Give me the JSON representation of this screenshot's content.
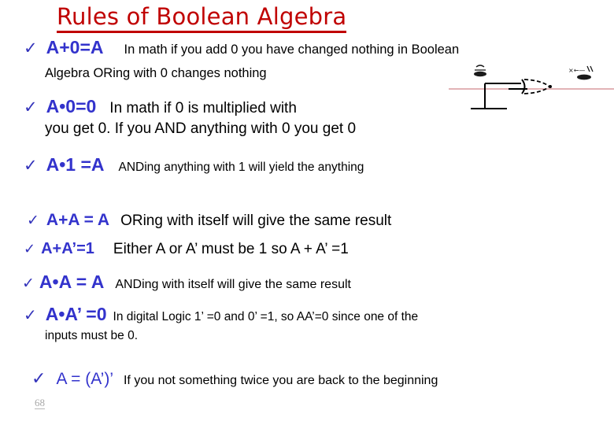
{
  "slide": {
    "title": "Rules of Boolean Algebra",
    "title_color": "#c00000",
    "expr_color": "#3333cc",
    "check_color": "#3333bb",
    "body_color": "#000000",
    "background": "#ffffff",
    "page_number": "68",
    "check_glyph": "✓"
  },
  "rules": [
    {
      "id": "rule-a-plus-0",
      "expression": "A+0=A",
      "description": "In math if you add 0 you have changed nothing in Boolean",
      "continuation": "Algebra ORing with 0 changes nothing"
    },
    {
      "id": "rule-a-times-0",
      "expression": "A•0=0",
      "description": "In math if 0 is multiplied with",
      "continuation": "you get 0. If you AND anything with 0 you get 0"
    },
    {
      "id": "rule-a-times-1",
      "expression": "A•1 =A",
      "description": "ANDing anything with 1 will yield the anything",
      "continuation": ""
    },
    {
      "id": "rule-a-plus-a",
      "expression": "A+A = A",
      "description": "ORing with itself will give the same result",
      "continuation": ""
    },
    {
      "id": "rule-a-plus-a-not",
      "expression": "A+A’=1",
      "description": "Either A or A’ must be 1 so A + A’ =1",
      "continuation": ""
    },
    {
      "id": "rule-a-times-a",
      "expression": "A•A = A",
      "description": "ANDing with itself will give the same result",
      "continuation": ""
    },
    {
      "id": "rule-a-times-a-not",
      "expression": "A•A’ =0",
      "description": "In digital Logic 1’ =0 and 0’ =1, so AA’=0 since one of the",
      "continuation": "inputs must be 0."
    },
    {
      "id": "rule-double-negation",
      "expression": "A = (A’)’",
      "description": "If you not something twice you are back to the beginning",
      "continuation": ""
    }
  ],
  "diagram": {
    "name": "logic-gate-sketch",
    "rule_line_color": "#d99a9e",
    "stroke_color": "#000000"
  }
}
